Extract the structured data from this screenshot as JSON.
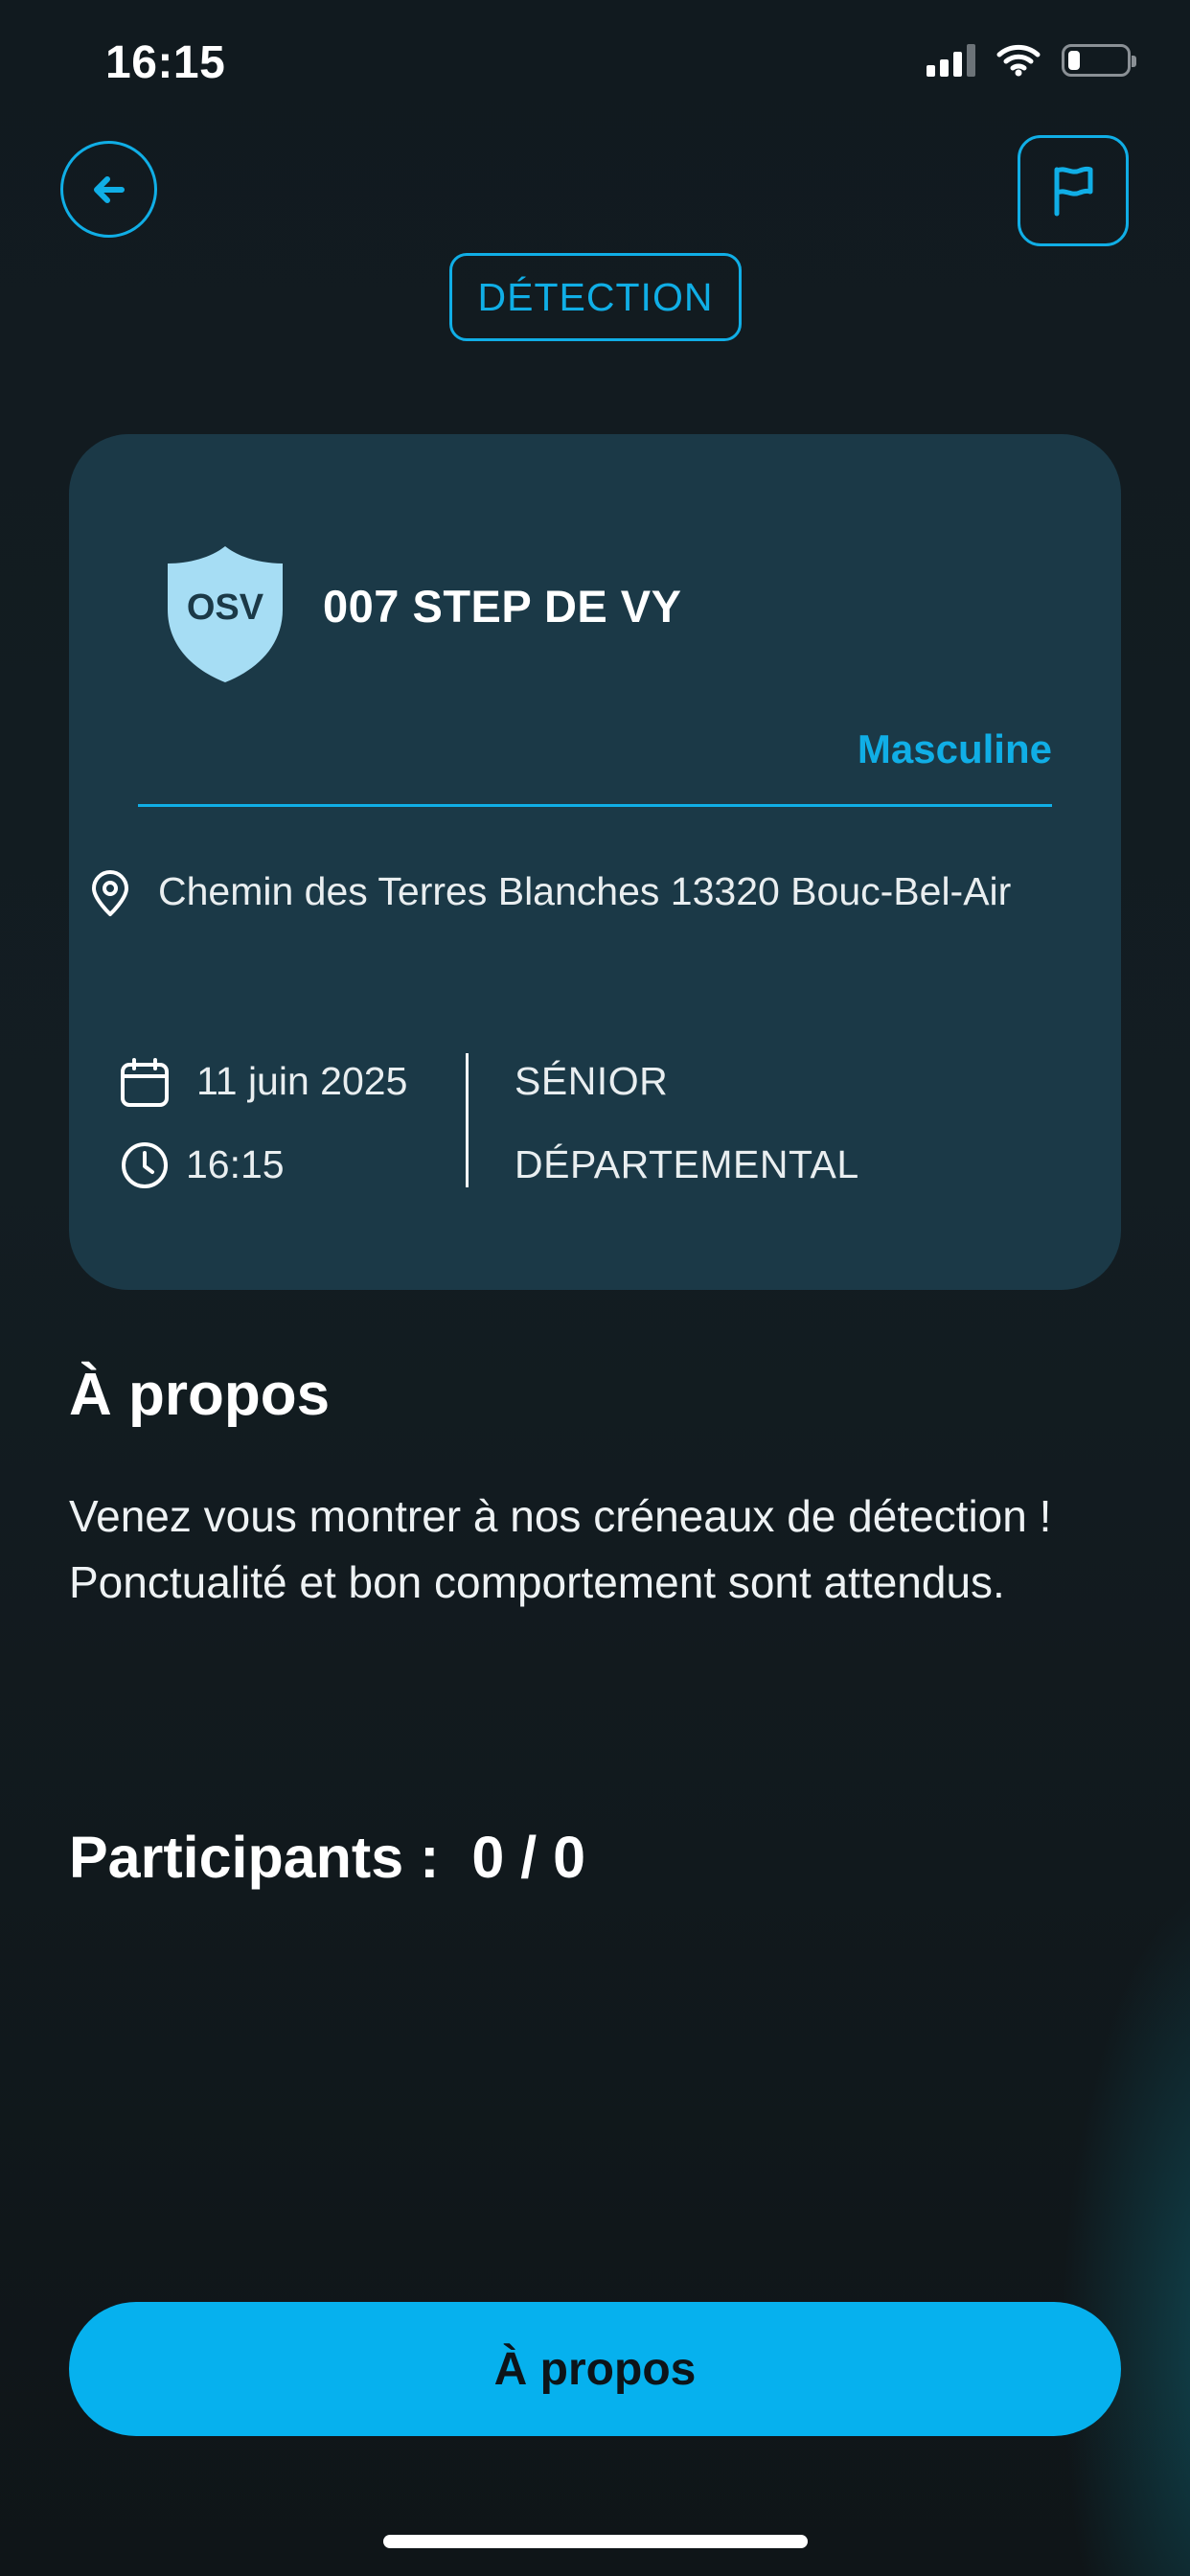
{
  "status_bar": {
    "time": "16:15"
  },
  "header": {
    "tag": "DÉTECTION"
  },
  "event": {
    "club_logo_text": "OSV",
    "club_name": "007 STEP DE VY",
    "gender": "Masculine",
    "address": "Chemin des Terres Blanches 13320 Bouc-Bel-Air",
    "date": "11 juin 2025",
    "time": "16:15",
    "category": "SÉNIOR",
    "level": "DÉPARTEMENTAL"
  },
  "about": {
    "heading": "À propos",
    "line1": "Venez vous montrer à nos créneaux de détection !",
    "line2": "Ponctualité et bon comportement sont attendus."
  },
  "participants": {
    "label": "Participants :  0 / 0"
  },
  "cta": {
    "label": "À propos"
  },
  "colors": {
    "accent": "#10aee6",
    "card_bg": "#1b3947",
    "page_bg": "#131d22",
    "cta_bg": "#06b1ee",
    "logo_shield": "#a6ddf4"
  },
  "icons": {
    "back": "arrow-left-icon",
    "report": "flag-icon",
    "location": "location-pin-icon",
    "date": "calendar-icon",
    "time": "clock-icon"
  }
}
